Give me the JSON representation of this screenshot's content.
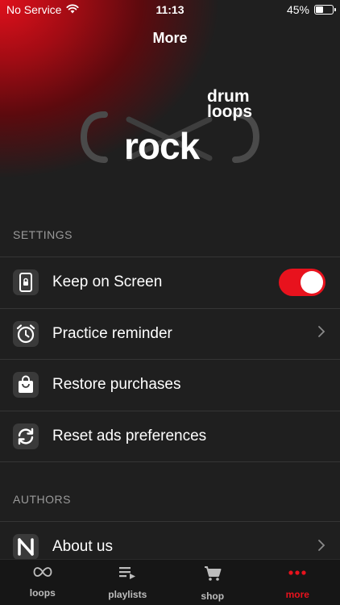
{
  "status_bar": {
    "carrier": "No Service",
    "time": "11:13",
    "battery_percent_label": "45%",
    "battery_level": 0.45
  },
  "nav": {
    "title": "More"
  },
  "logo": {
    "word": "rock",
    "tagline_line1": "drum",
    "tagline_line2": "loops"
  },
  "settings": {
    "header": "SETTINGS",
    "items": [
      {
        "label": "Keep on Screen",
        "icon": "phone-lock-icon",
        "control": "toggle",
        "toggle_on": true
      },
      {
        "label": "Practice reminder",
        "icon": "alarm-clock-icon",
        "control": "chevron"
      },
      {
        "label": "Restore purchases",
        "icon": "shopping-bag-icon",
        "control": "none"
      },
      {
        "label": "Reset ads preferences",
        "icon": "refresh-icon",
        "control": "none"
      }
    ]
  },
  "authors": {
    "header": "AUTHORS",
    "items": [
      {
        "label": "About us",
        "icon": "brand-n-icon",
        "control": "chevron"
      }
    ]
  },
  "tabbar": {
    "tabs": [
      {
        "label": "loops",
        "icon": "infinity-icon",
        "active": false
      },
      {
        "label": "playlists",
        "icon": "playlist-icon",
        "active": false
      },
      {
        "label": "shop",
        "icon": "cart-icon",
        "active": false
      },
      {
        "label": "more",
        "icon": "dots-icon",
        "active": true
      }
    ]
  },
  "colors": {
    "accent": "#e8121d",
    "background": "#1f1f1f",
    "icon_tile": "#3a3a3a",
    "separator": "#353535",
    "section_text": "#9a9a9a"
  }
}
